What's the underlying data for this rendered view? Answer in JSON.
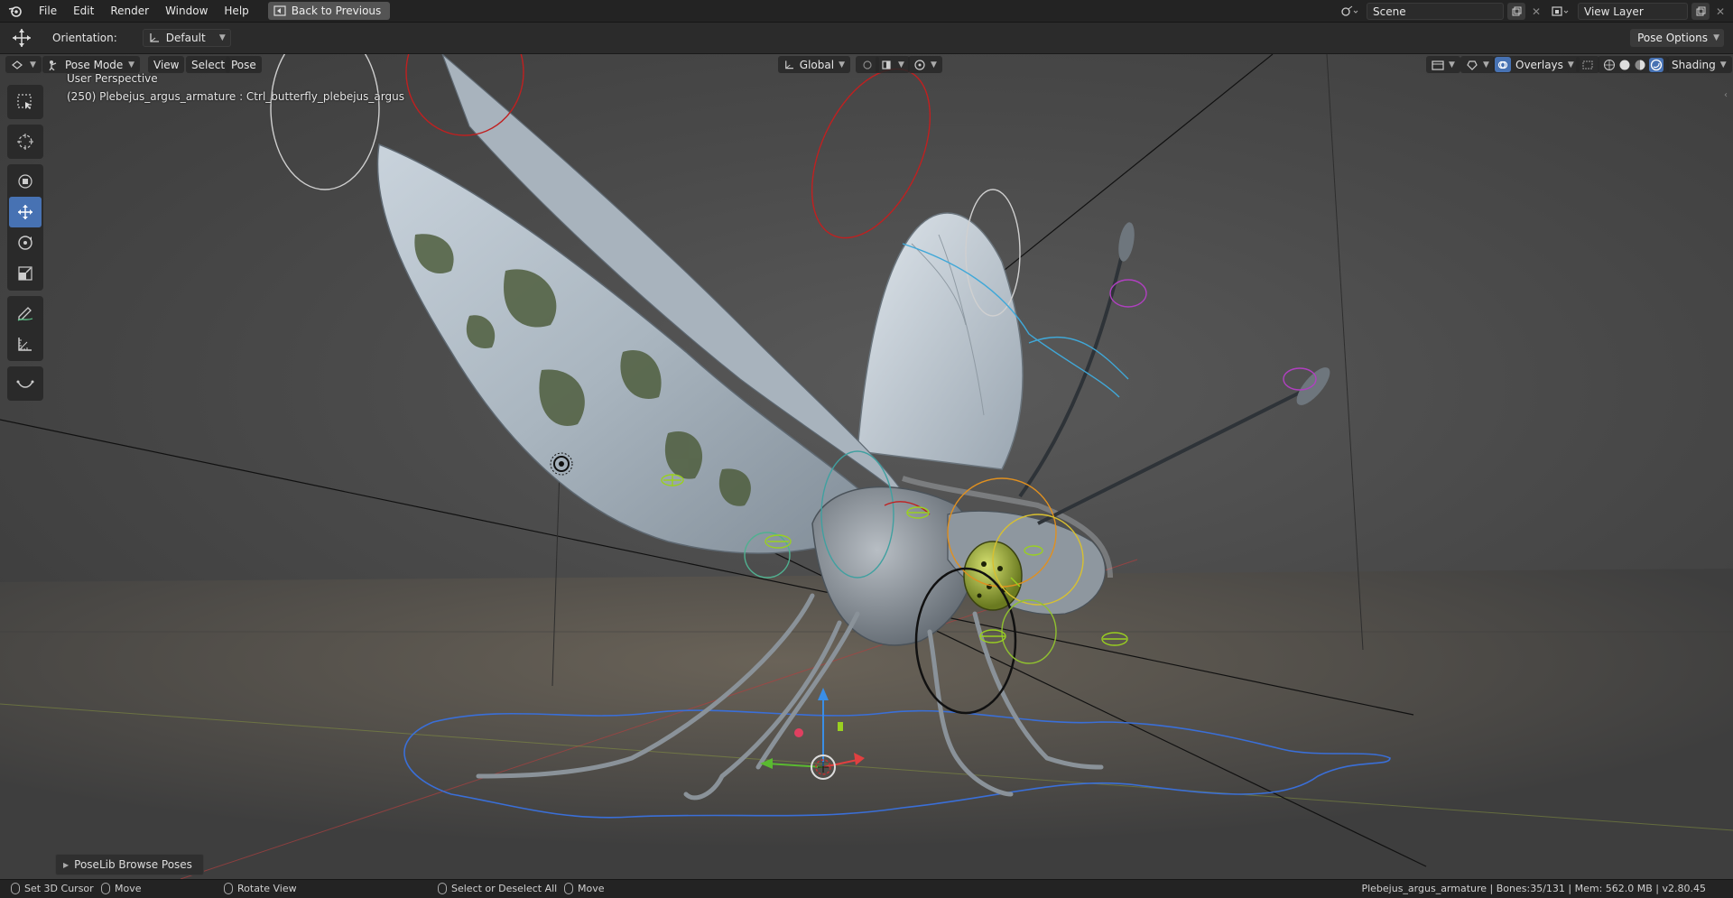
{
  "topbar": {
    "menu": [
      "File",
      "Edit",
      "Render",
      "Window",
      "Help"
    ],
    "back_label": "Back to Previous",
    "scene": "Scene",
    "view_layer": "View Layer"
  },
  "toolheader": {
    "orientation_label": "Orientation:",
    "orientation_value": "Default",
    "pose_options": "Pose Options"
  },
  "viewport": {
    "mode": "Pose Mode",
    "menus": [
      "View",
      "Select",
      "Pose"
    ],
    "transform_space": "Global",
    "overlays": "Overlays",
    "shading": "Shading",
    "perspective": "User Perspective",
    "active_object": "(250) Plebejus_argus_armature : Ctrl_butterfly_plebejus_argus",
    "poselib": "PoseLib Browse Poses"
  },
  "statusbar": {
    "items": [
      "Set 3D Cursor",
      "Move",
      "Rotate View",
      "Select or Deselect All",
      "Move"
    ],
    "info": "Plebejus_argus_armature | Bones:35/131 | Mem: 562.0 MB | v2.80.45"
  },
  "colors": {
    "accent": "#4772b3",
    "header_bg": "#232323",
    "viewport_bg": "#4a4a4a"
  }
}
